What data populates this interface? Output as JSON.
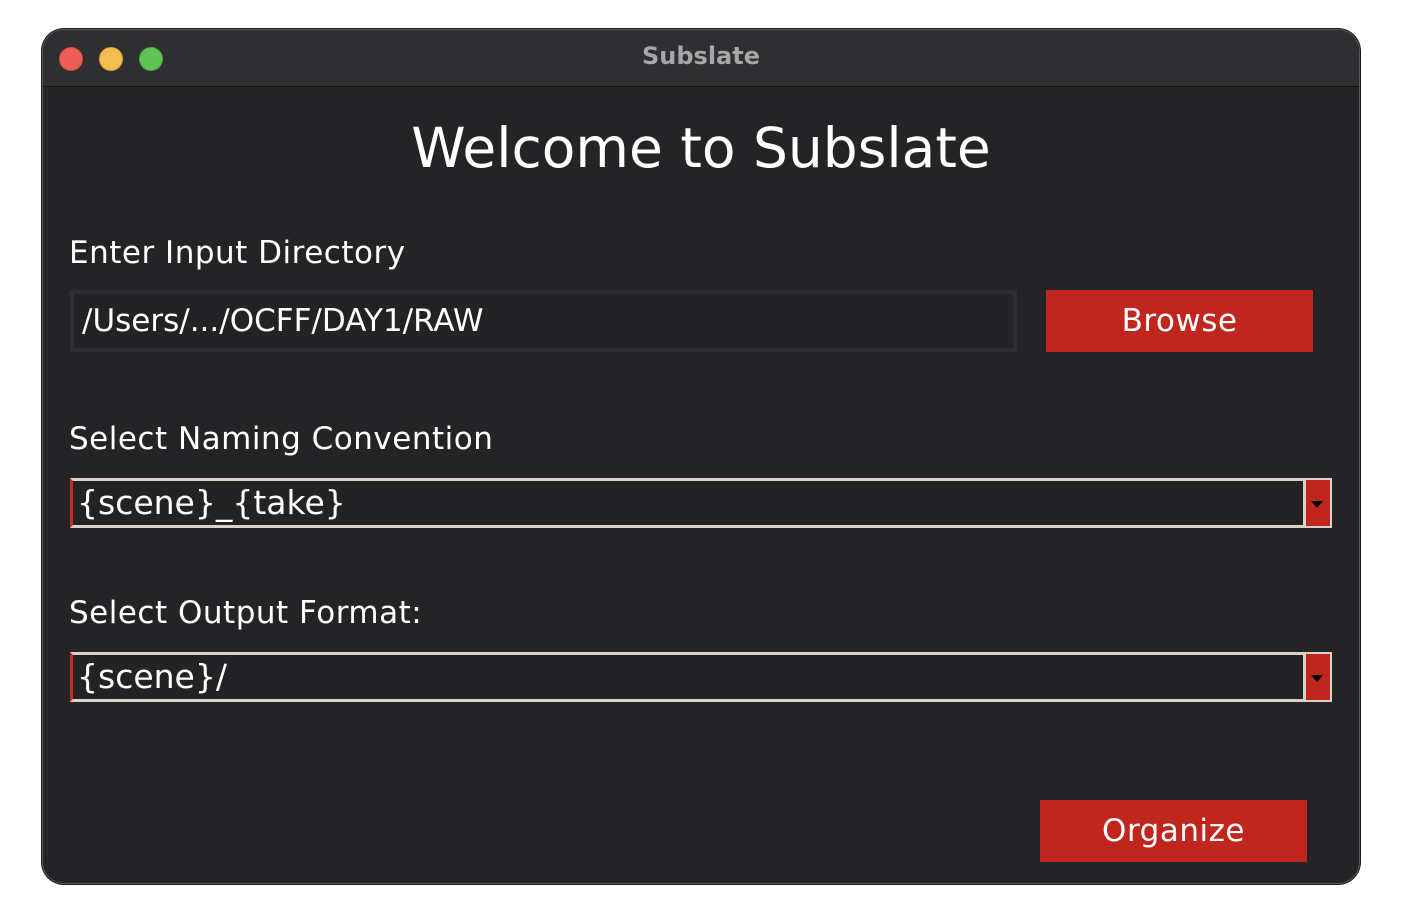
{
  "window": {
    "title": "Subslate"
  },
  "main": {
    "heading": "Welcome to Subslate",
    "input_directory": {
      "label": "Enter Input Directory",
      "value": "/Users/.../OCFF/DAY1/RAW",
      "browse_label": "Browse"
    },
    "naming_convention": {
      "label": "Select Naming Convention",
      "selected": "{scene}_{take}"
    },
    "output_format": {
      "label": "Select Output Format:",
      "selected": "{scene}/"
    },
    "organize_label": "Organize"
  },
  "colors": {
    "window_bg": "#242426",
    "accent": "#c0261e",
    "text": "#ffffff"
  },
  "icons": {
    "close": "close-traffic-light",
    "minimize": "minimize-traffic-light",
    "maximize": "maximize-traffic-light",
    "dropdown": "chevron-down-icon"
  }
}
